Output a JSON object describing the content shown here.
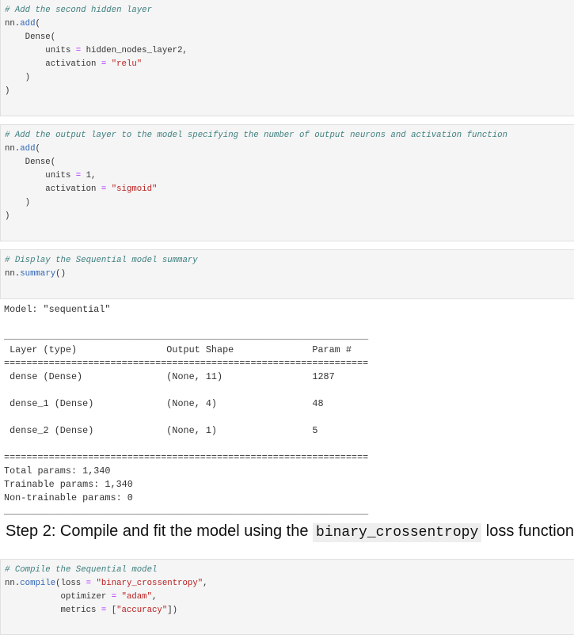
{
  "cells": [
    {
      "name": "code-cell-second-hidden-layer",
      "lines": [
        [
          [
            "# Add the second hidden layer",
            "c"
          ]
        ],
        [
          [
            "nn.",
            "p"
          ],
          [
            "add",
            "f"
          ],
          [
            "(",
            "p"
          ]
        ],
        [
          [
            "    Dense(",
            "p"
          ]
        ],
        [
          [
            "        units ",
            "p"
          ],
          [
            "=",
            "o"
          ],
          [
            " hidden_nodes_layer2,",
            "p"
          ]
        ],
        [
          [
            "        activation ",
            "p"
          ],
          [
            "=",
            "o"
          ],
          [
            " ",
            "p"
          ],
          [
            "\"relu\"",
            "s"
          ]
        ],
        [
          [
            "    )",
            "p"
          ]
        ],
        [
          [
            ")",
            "p"
          ]
        ]
      ]
    },
    {
      "name": "code-cell-output-layer",
      "lines": [
        [
          [
            "# Add the output layer to the model specifying the number of output neurons and activation function",
            "c"
          ]
        ],
        [
          [
            "nn.",
            "p"
          ],
          [
            "add",
            "f"
          ],
          [
            "(",
            "p"
          ]
        ],
        [
          [
            "    Dense(",
            "p"
          ]
        ],
        [
          [
            "        units ",
            "p"
          ],
          [
            "=",
            "o"
          ],
          [
            " 1,",
            "p"
          ]
        ],
        [
          [
            "        activation ",
            "p"
          ],
          [
            "=",
            "o"
          ],
          [
            " ",
            "p"
          ],
          [
            "\"sigmoid\"",
            "s"
          ]
        ],
        [
          [
            "    )",
            "p"
          ]
        ],
        [
          [
            ")",
            "p"
          ]
        ]
      ]
    },
    {
      "name": "code-cell-summary",
      "lines": [
        [
          [
            "# Display the Sequential model summary",
            "c"
          ]
        ],
        [
          [
            "nn.",
            "p"
          ],
          [
            "summary",
            "f"
          ],
          [
            "()",
            "p"
          ]
        ]
      ]
    },
    {
      "name": "code-cell-compile",
      "lines": [
        [
          [
            "# Compile the Sequential model",
            "c"
          ]
        ],
        [
          [
            "nn.",
            "p"
          ],
          [
            "compile",
            "f"
          ],
          [
            "(loss ",
            "p"
          ],
          [
            "=",
            "o"
          ],
          [
            " ",
            "p"
          ],
          [
            "\"binary_crossentropy\"",
            "s"
          ],
          [
            ",",
            "p"
          ]
        ],
        [
          [
            "           optimizer ",
            "p"
          ],
          [
            "=",
            "o"
          ],
          [
            " ",
            "p"
          ],
          [
            "\"adam\"",
            "s"
          ],
          [
            ",",
            "p"
          ]
        ],
        [
          [
            "           metrics ",
            "p"
          ],
          [
            "=",
            "o"
          ],
          [
            " [",
            "p"
          ],
          [
            "\"accuracy\"",
            "s"
          ],
          [
            "])",
            "p"
          ]
        ]
      ]
    }
  ],
  "output": {
    "lines": [
      "Model: \"sequential\"",
      "_________________________________________________________________",
      " Layer (type)                Output Shape              Param #   ",
      "=================================================================",
      " dense (Dense)               (None, 11)                1287      ",
      "",
      " dense_1 (Dense)             (None, 4)                 48        ",
      "",
      " dense_2 (Dense)             (None, 1)                 5         ",
      "",
      "=================================================================",
      "Total params: 1,340",
      "Trainable params: 1,340",
      "Non-trainable params: 0",
      "_________________________________________________________________"
    ]
  },
  "heading": {
    "prefix": "Step 2: Compile and fit the model using the ",
    "code": "binary_crossentropy",
    "suffix": " loss function"
  }
}
